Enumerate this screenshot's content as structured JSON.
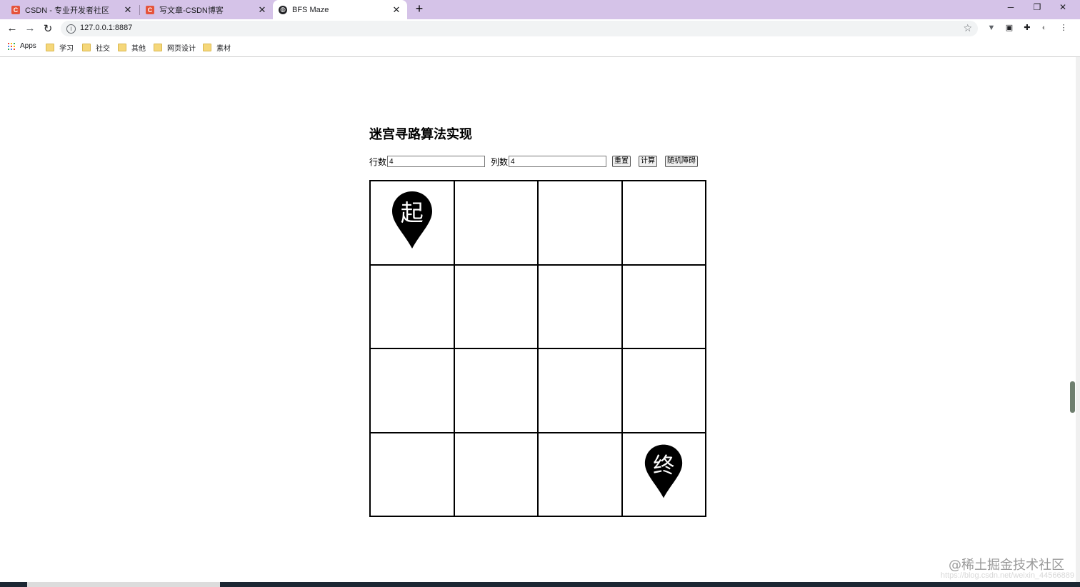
{
  "browser": {
    "tabs": [
      {
        "title": "CSDN - 专业开发者社区",
        "icon": "csdn-icon",
        "active": false
      },
      {
        "title": "写文章-CSDN博客",
        "icon": "csdn-icon",
        "active": false
      },
      {
        "title": "BFS Maze",
        "icon": "globe-icon",
        "active": true
      }
    ],
    "new_tab_glyph": "+",
    "address": "127.0.0.1:8887",
    "bookmarks": [
      {
        "label": "Apps",
        "icon": "apps-grid-icon"
      },
      {
        "label": "学习",
        "icon": "folder-icon"
      },
      {
        "label": "社交",
        "icon": "folder-icon"
      },
      {
        "label": "其他",
        "icon": "folder-icon"
      },
      {
        "label": "网页设计",
        "icon": "folder-icon"
      },
      {
        "label": "素材",
        "icon": "folder-icon"
      }
    ]
  },
  "page": {
    "title": "迷宫寻路算法实现",
    "rows_label": "行数",
    "rows_value": "4",
    "cols_label": "列数",
    "cols_value": "4",
    "reset_button": "重置",
    "compute_button": "计算",
    "random_button": "随机障碍"
  },
  "maze": {
    "rows": 4,
    "cols": 4,
    "start": {
      "row": 0,
      "col": 0,
      "label": "起"
    },
    "end": {
      "row": 3,
      "col": 3,
      "label": "终"
    }
  },
  "watermark": {
    "main": "@稀土掘金技术社区",
    "sub": "https://blog.csdn.net/weixin_44566889"
  }
}
